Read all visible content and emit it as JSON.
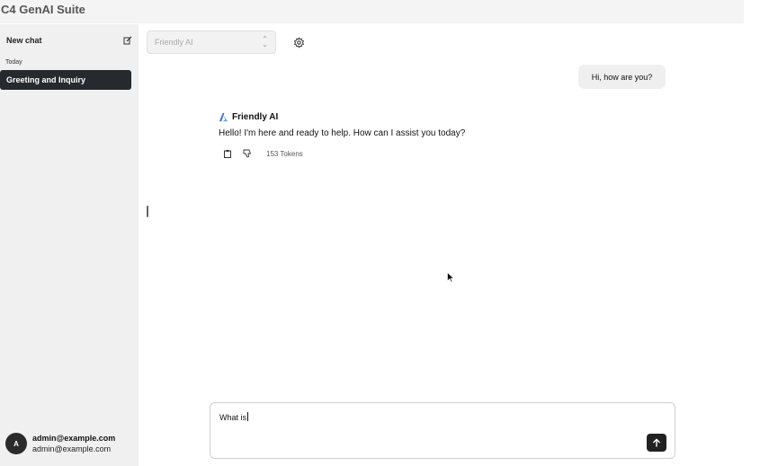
{
  "app": {
    "title": "C4 GenAI Suite"
  },
  "sidebar": {
    "new_chat_label": "New chat",
    "section_label": "Today",
    "items": [
      {
        "label": "Greeting and Inquiry"
      }
    ],
    "user": {
      "initial": "A",
      "name": "admin@example.com",
      "email": "admin@example.com"
    }
  },
  "header": {
    "model_select": {
      "value": "Friendly AI"
    }
  },
  "conversation": {
    "user_message": "Hi, how are you?",
    "assistant": {
      "name": "Friendly AI",
      "message": "Hello! I'm here and ready to help. How can I assist you today?",
      "tokens": "153 Tokens"
    }
  },
  "composer": {
    "value": "What is"
  },
  "icons": {
    "new_chat": "edit-icon",
    "settings": "gear-icon",
    "assistant_logo": "azure-logo-icon",
    "copy": "clipboard-icon",
    "dislike": "thumbs-down-icon",
    "send": "arrow-up-icon",
    "select": "chevron-up-down-icon"
  },
  "colors": {
    "accent_dark": "#262a2e",
    "logo_blue": "#3b6fd6"
  }
}
